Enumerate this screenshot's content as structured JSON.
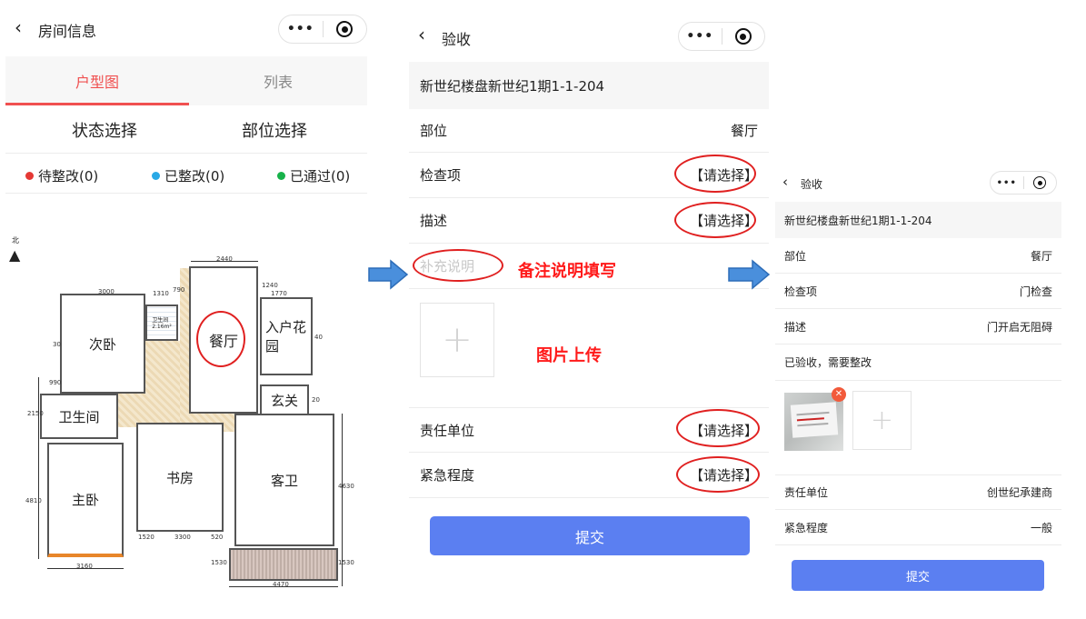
{
  "screen1": {
    "nav_title": "房间信息",
    "tabs": [
      {
        "label": "户型图"
      },
      {
        "label": "列表"
      }
    ],
    "filters": {
      "status": "状态选择",
      "part": "部位选择"
    },
    "legend": [
      {
        "label": "待整改(0)",
        "color": "#e53935"
      },
      {
        "label": "已整改(0)",
        "color": "#29a9e6"
      },
      {
        "label": "已通过(0)",
        "color": "#17b24a"
      }
    ],
    "accent": "#f05050",
    "plan": {
      "north": "北",
      "rooms": {
        "ciwo": "次卧",
        "canting": "餐厅",
        "rhuhu": "入户花\n园",
        "xuanguan": "玄关",
        "weishengjian": "卫生间",
        "shufang": "书房",
        "kewei": "客卫",
        "zhuwo": "主卧",
        "small_toilet": "卫生间\n2.16m²"
      },
      "dims": [
        "2440",
        "1310",
        "790",
        "1240",
        "1770",
        "3000",
        "990",
        "2150",
        "4810",
        "1520",
        "3300",
        "520",
        "3160",
        "4470",
        "1530",
        "1530",
        "4630",
        "20",
        "40",
        "30"
      ]
    }
  },
  "screen2": {
    "nav_title": "验收",
    "address": "新世纪楼盘新世纪1期1-1-204",
    "rows": [
      {
        "label": "部位",
        "value": "餐厅"
      },
      {
        "label": "检查项",
        "value": "【请选择】"
      },
      {
        "label": "描述",
        "value": "【请选择】"
      }
    ],
    "remark_placeholder": "补充说明",
    "annotation_remark": "备注说明填写",
    "annotation_upload": "图片上传",
    "rows2": [
      {
        "label": "责任单位",
        "value": "【请选择】"
      },
      {
        "label": "紧急程度",
        "value": "【请选择】"
      }
    ],
    "submit": "提交",
    "submit_color": "#5b7ff1"
  },
  "screen3": {
    "nav_title": "验收",
    "address": "新世纪楼盘新世纪1期1-1-204",
    "rows": [
      {
        "label": "部位",
        "value": "餐厅"
      },
      {
        "label": "检查项",
        "value": "门检查"
      },
      {
        "label": "描述",
        "value": "门开启无阻碍"
      }
    ],
    "remark": "已验收，需要整改",
    "rows2": [
      {
        "label": "责任单位",
        "value": "创世纪承建商"
      },
      {
        "label": "紧急程度",
        "value": "一般"
      }
    ],
    "submit": "提交",
    "submit_color": "#5b7ff1"
  }
}
